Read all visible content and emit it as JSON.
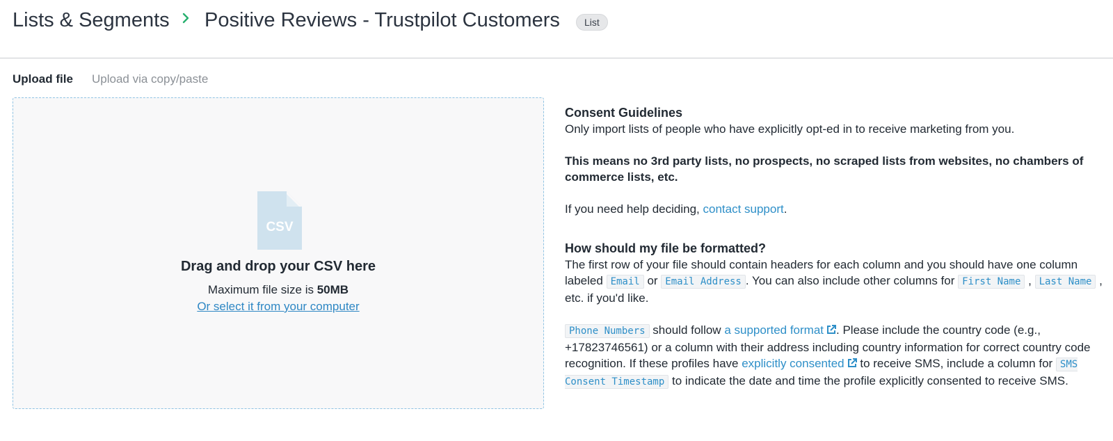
{
  "header": {
    "breadcrumb_root": "Lists & Segments",
    "title": "Positive Reviews - Trustpilot Customers",
    "badge": "List"
  },
  "tabs": {
    "upload": "Upload file",
    "paste": "Upload via copy/paste"
  },
  "dropzone": {
    "icon_label": "CSV",
    "title": "Drag and drop your CSV here",
    "size_prefix": "Maximum file size is ",
    "size_value": "50MB",
    "select_link": "Or select it from your computer"
  },
  "consent": {
    "heading": "Consent Guidelines",
    "line1": "Only import lists of people who have explicitly opt-ed in to receive marketing from you.",
    "line2": "This means no 3rd party lists, no prospects, no scraped lists from websites, no chambers of commerce lists, etc.",
    "help_prefix": "If you need help deciding, ",
    "help_link": "contact support",
    "help_suffix": "."
  },
  "format": {
    "heading": "How should my file be formatted?",
    "p1_a": "The first row of your file should contain headers for each column and you should have one column labeled ",
    "code_email": "Email",
    "p1_or": " or ",
    "code_email_address": "Email Address",
    "p1_b": ". You can also include other columns for ",
    "code_first_name": "First Name",
    "p1_comma": " , ",
    "code_last_name": "Last Name",
    "p1_c": " , etc. if you'd like.",
    "code_phone": "Phone Numbers",
    "p2_a": " should follow ",
    "supported_format_link": "a supported format",
    "p2_b": ".   Please include the country code (e.g., +17823746561) or a column with their address including country information for correct country code recognition. If these profiles have ",
    "consented_link": "explicitly consented",
    "p2_c": "  to receive SMS, include a column for ",
    "code_sms": "SMS Consent Timestamp",
    "p2_d": " to indicate the date and time the profile explicitly consented to receive SMS."
  },
  "colors": {
    "accent_link": "#2e8fc8",
    "breadcrumb_chevron": "#27b06e",
    "dropzone_border": "#8fc3e3",
    "csv_icon": "#cfe2ee"
  },
  "icons": {
    "breadcrumb_separator": "chevron-right-icon",
    "file": "csv-file-icon",
    "external": "external-link-icon"
  }
}
